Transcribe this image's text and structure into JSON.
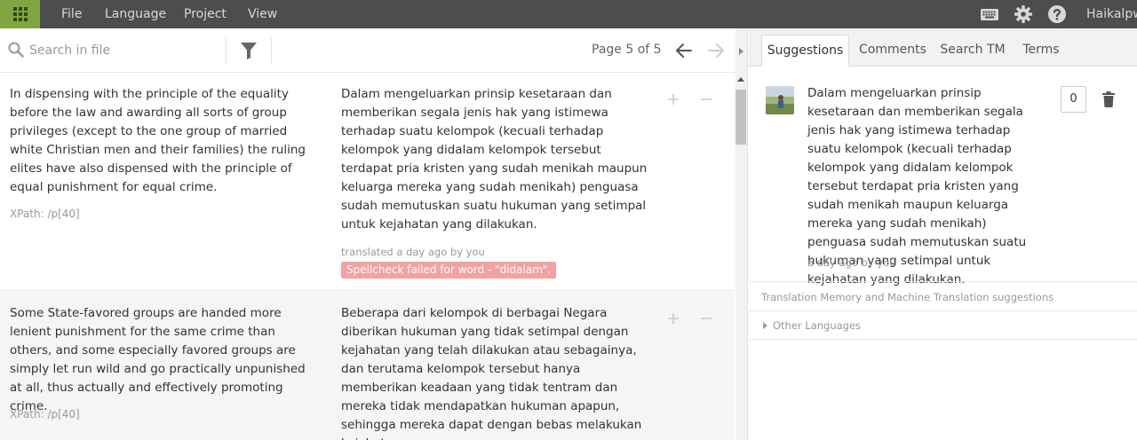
{
  "menu": {
    "file": "File",
    "language": "Language",
    "project": "Project",
    "view": "View"
  },
  "user": {
    "name": "Haikalpw"
  },
  "toolbar": {
    "search_placeholder": "Search in file",
    "page_label": "Page 5 of 5"
  },
  "rows": [
    {
      "source": "In dispensing with the principle of the equality before the law and awarding all sorts of group privileges (except to the one group of married white Christian men and their families) the ruling elites have also dispensed with the principle of equal punishment for equal crime.",
      "xpath": "XPath: /p[40]",
      "target": "Dalam mengeluarkan prinsip kesetaraan dan memberikan segala jenis hak yang istimewa terhadap suatu kelompok (kecuali terhadap kelompok yang didalam kelompok tersebut terdapat pria kristen yang sudah menikah maupun keluarga mereka yang sudah menikah) penguasa sudah memutuskan suatu hukuman yang setimpal untuk kejahatan yang dilakukan.",
      "meta": "translated a day ago by you",
      "spellcheck": "Spellcheck failed for word - \"didalam\"."
    },
    {
      "source": "Some State-favored groups are handed more lenient punishment for the same crime than others, and some especially favored groups are simply let run wild and go practically unpunished at all, thus actually and effectively promoting crime.",
      "xpath": "XPath: /p[40]",
      "target": "Beberapa dari kelompok di berbagai Negara diberikan hukuman yang tidak setimpal dengan kejahatan yang telah dilakukan atau sebagainya, dan terutama kelompok tersebut hanya memberikan keadaan yang tidak tentram dan mereka tidak mendapatkan hukuman apapun, sehingga mereka dapat dengan bebas melakukan kejahatan."
    }
  ],
  "tabs": {
    "suggestions": "Suggestions",
    "comments": "Comments",
    "search_tm": "Search TM",
    "terms": "Terms"
  },
  "suggestion": {
    "text": "Dalam mengeluarkan prinsip kesetaraan dan memberikan segala jenis hak yang istimewa terhadap suatu kelompok (kecuali terhadap kelompok yang didalam kelompok tersebut terdapat pria kristen yang sudah menikah maupun keluarga mereka yang sudah menikah) penguasa sudah memutuskan suatu hukuman yang setimpal untuk kejahatan yang dilakukan.",
    "meta": "a day ago by you",
    "count": "0"
  },
  "tm": {
    "label": "Translation Memory and Machine Translation suggestions",
    "other_languages": "Other Languages"
  },
  "colors": {
    "topbar": "#4d4d4d",
    "apps_green": "#7ea641",
    "spell_badge": "#f1a2a2"
  }
}
